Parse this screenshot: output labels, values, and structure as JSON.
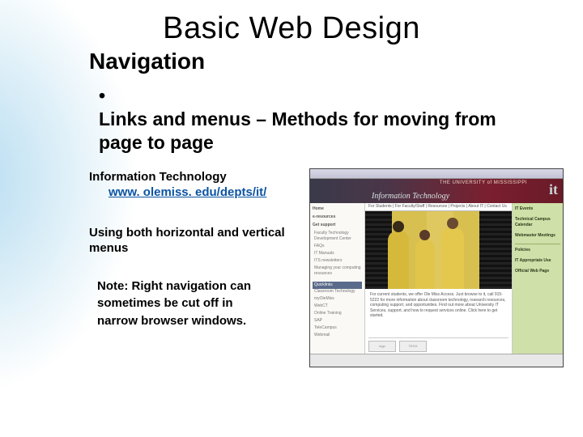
{
  "title": "Basic Web Design",
  "subtitle": "Navigation",
  "bullet": "Links and menus – Methods for moving from page to page",
  "left": {
    "info_label": "Information Technology",
    "info_link": "www. olemiss. edu/depts/it/",
    "using": "Using both horizontal and vertical menus",
    "note": "Note: Right navigation can sometimes be cut off in narrow browser windows."
  },
  "screenshot": {
    "university": "THE UNIVERSITY of MISSISSIPPI",
    "dept": "Information Technology",
    "logo": "it",
    "top_tabs": "For Students | For Faculty/Staff | Resources | Projects | About IT | Contact Us",
    "left_nav": {
      "items": [
        "Home",
        "e-resources",
        "Get support"
      ],
      "subs": [
        "Faculty Technology Development Center",
        "FAQs",
        "IT Manuals",
        "ITS newsletters",
        "Managing your computing resources"
      ],
      "quicklinks_hd": "Quicklinks",
      "quicklinks": [
        "Classroom Technology",
        "myOleMiss",
        "WebCT",
        "Online Training",
        "SAP",
        "TeleCampus",
        "Webmail"
      ]
    },
    "right_nav": {
      "items": [
        "IT Events",
        "Technical Campus Calendar",
        "Webmaster Meetings"
      ],
      "items2": [
        "Policies",
        "IT Appropriate Use",
        "Official Web Page"
      ]
    },
    "blurb": "For current students, we offer Ole Miss Access. Just browse to it, call 915-5222 for more information about classroom technology, research resources, computing support, and opportunities. Find out more about University IT Services, support, and how to request services online. Click here to get started."
  }
}
